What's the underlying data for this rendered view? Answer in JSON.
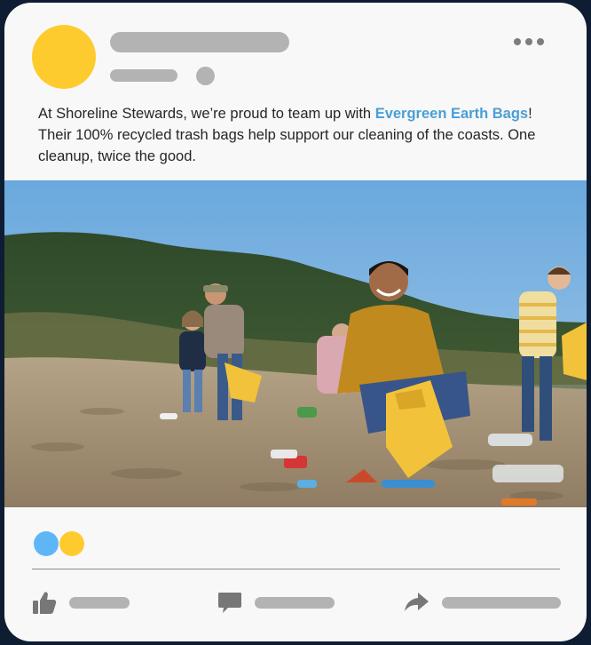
{
  "post": {
    "text_before": "At Shoreline Stewards, we’re proud to team up with ",
    "brand_link": "Evergreen Earth Bags",
    "text_after": "! Their 100% recycled trash bags help support our cleaning of the coasts. One cleanup, twice the good."
  },
  "colors": {
    "avatar": "#fecb2f",
    "brand_link": "#4a9ed8",
    "reaction_like": "#5eb6f6",
    "reaction_love": "#fecb2f",
    "placeholder": "#b3b3b3",
    "icon": "#777777"
  },
  "icons": {
    "menu": "more-horizontal-icon",
    "like": "thumbs-up-icon",
    "comment": "comment-icon",
    "share": "share-arrow-icon"
  },
  "photo": {
    "scene": "beach-cleanup-volunteers"
  }
}
